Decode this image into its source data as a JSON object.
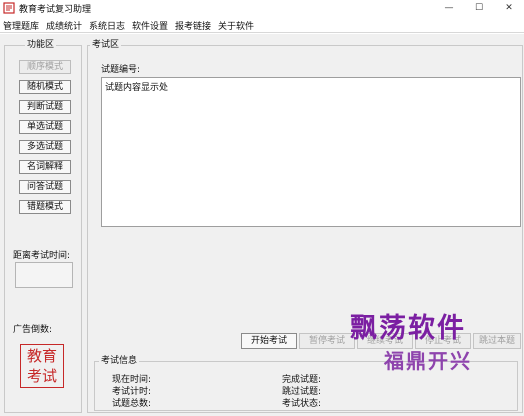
{
  "window": {
    "title": "教育考试复习助理",
    "minimize": "—",
    "maximize": "☐",
    "close": "✕"
  },
  "menu": [
    "管理题库",
    "成绩统计",
    "系统日志",
    "软件设置",
    "报考链接",
    "关于软件"
  ],
  "sidebar": {
    "title": "功能区",
    "buttons": [
      {
        "label": "顺序模式",
        "enabled": false
      },
      {
        "label": "随机模式",
        "enabled": true
      },
      {
        "label": "判断试题",
        "enabled": true
      },
      {
        "label": "单选试题",
        "enabled": true
      },
      {
        "label": "多选试题",
        "enabled": true
      },
      {
        "label": "名词解释",
        "enabled": true
      },
      {
        "label": "问答试题",
        "enabled": true
      },
      {
        "label": "错题模式",
        "enabled": true
      }
    ],
    "timer_label": "距离考试时间:",
    "ad_label": "广告倒数:",
    "seal_text": [
      "教育",
      "考试"
    ]
  },
  "exam": {
    "title": "考试区",
    "question_number_label": "试题编号:",
    "question_placeholder": "试题内容显示处",
    "actions": [
      {
        "label": "开始考试",
        "enabled": true
      },
      {
        "label": "暂停考试",
        "enabled": false
      },
      {
        "label": "继续考试",
        "enabled": false
      },
      {
        "label": "停止考试",
        "enabled": false
      },
      {
        "label": "跳过本题",
        "enabled": false
      }
    ],
    "info": {
      "title": "考试信息",
      "current_time_label": "现在时间:",
      "elapsed_label": "考试计时:",
      "total_label": "试题总数:",
      "completed_label": "完成试题:",
      "skipped_label": "跳过试题:",
      "status_label": "考试状态:"
    }
  },
  "watermark": {
    "line1": "飘荡软件",
    "line2": "福鼎开兴"
  },
  "colors": {
    "seal_red": "#c62828",
    "watermark_purple": "#7b1fa2"
  }
}
